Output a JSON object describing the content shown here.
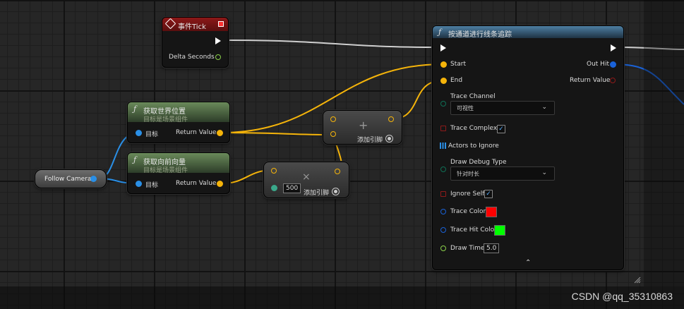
{
  "nodes": {
    "tick": {
      "title": "事件Tick",
      "output_label": "Delta Seconds"
    },
    "get_world_location": {
      "title": "获取世界位置",
      "subtitle": "目标是场景组件",
      "target_label": "目标",
      "return_label": "Return Value"
    },
    "get_forward_vector": {
      "title": "获取向前向量",
      "subtitle": "目标是场景组件",
      "target_label": "目标",
      "return_label": "Return Value"
    },
    "follow_camera": {
      "label": "Follow Camera"
    },
    "add_top": {
      "symbol": "+",
      "add_pin_label": "添加引脚"
    },
    "multiply": {
      "symbol": "×",
      "value": "500",
      "add_pin_label": "添加引脚"
    },
    "line_trace": {
      "title": "按通道进行线条追踪",
      "start_label": "Start",
      "end_label": "End",
      "out_hit_label": "Out Hit",
      "return_label": "Return Value",
      "trace_channel_label": "Trace Channel",
      "trace_channel_value": "可视性",
      "trace_complex_label": "Trace Complex",
      "actors_to_ignore_label": "Actors to Ignore",
      "draw_debug_type_label": "Draw Debug Type",
      "draw_debug_type_value": "针对时长",
      "ignore_self_label": "Ignore Self",
      "trace_color_label": "Trace Color",
      "trace_color": "#ff0000",
      "trace_hit_color_label": "Trace Hit Color",
      "trace_hit_color": "#00ff00",
      "draw_time_label": "Draw Time",
      "draw_time_value": "5.0",
      "trace_complex_checked": true,
      "ignore_self_checked": true
    }
  },
  "watermark": "CSDN @qq_35310863",
  "colors": {
    "vector_pin": "#f5b40a",
    "object_pin": "#2a8fe6",
    "float_pin": "#8bd04a",
    "struct_pin": "#1a62d8",
    "bool_pin": "#8e1a1a",
    "enum_pin": "#0f6f55"
  }
}
